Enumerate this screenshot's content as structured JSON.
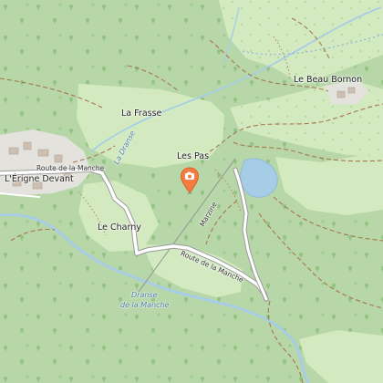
{
  "map": {
    "places": {
      "la_frasse": "La Frasse",
      "les_pas": "Les Pas",
      "le_beau_bornon": "Le Beau Bornon",
      "erigne_devant": "L'Érigne Devant",
      "le_charny": "Le Charny"
    },
    "roads": {
      "route_west": "Route de la Manche",
      "route_south": "Route de la Manche",
      "marzine": "Marzine"
    },
    "water": {
      "dranse_north": "La Dranse",
      "dranse_south_1": "Dranse",
      "dranse_south_2": "de la Manche"
    },
    "marker": {
      "icon": "map-pin-icon",
      "color": "#f47b41",
      "inner_icon": "camera-icon"
    },
    "colors": {
      "forest": "#b8d7a9",
      "meadow": "#d3eac0",
      "water": "#a7cde6",
      "track": "#a6764e",
      "road": "#ffffff"
    }
  }
}
